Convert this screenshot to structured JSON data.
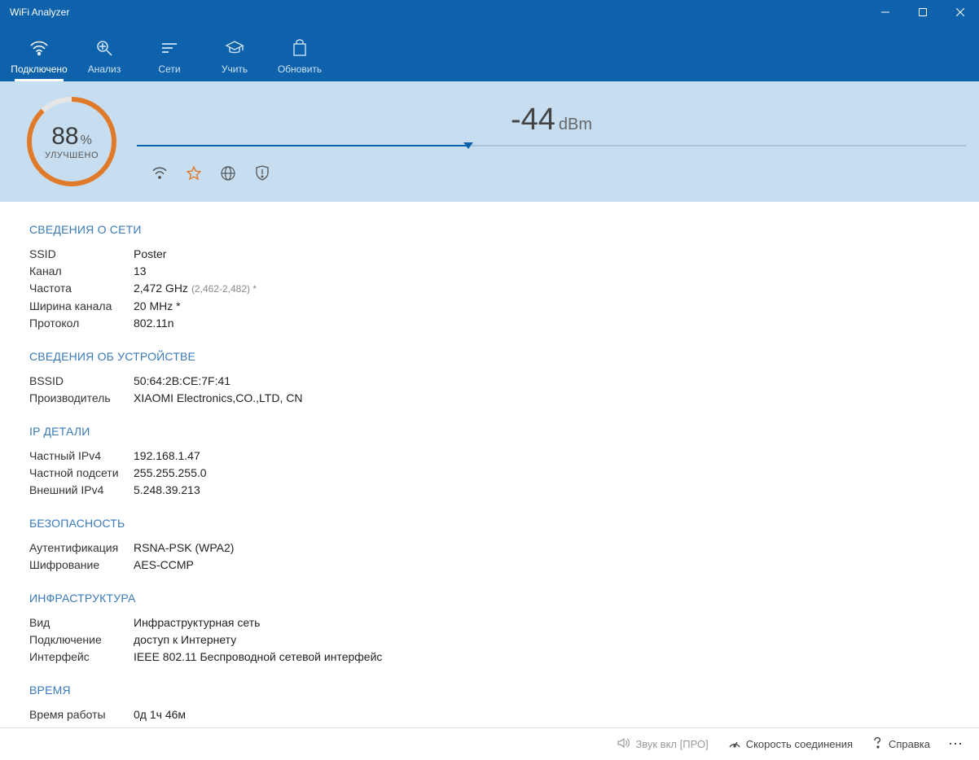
{
  "window": {
    "title": "WiFi Analyzer"
  },
  "toolbar": {
    "items": [
      {
        "label": "Подключено",
        "active": true
      },
      {
        "label": "Анализ",
        "active": false
      },
      {
        "label": "Cети",
        "active": false
      },
      {
        "label": "Учить",
        "active": false
      },
      {
        "label": "Обновить",
        "active": false
      }
    ]
  },
  "gauge": {
    "value": "88",
    "percent": "%",
    "sub": "УЛУЧШЕНО",
    "fill_percent": 88
  },
  "signal": {
    "value": "-44",
    "unit": "dBm",
    "fill_percent": 40
  },
  "sections": {
    "network": {
      "title": "СВЕДЕНИЯ О СЕТИ",
      "rows": [
        {
          "label": "SSID",
          "value": "Poster"
        },
        {
          "label": "Канал",
          "value": "13"
        },
        {
          "label": "Частота",
          "value": "2,472 GHz",
          "extra": "(2,462-2,482) *"
        },
        {
          "label": "Ширина канала",
          "value": "20 MHz *"
        },
        {
          "label": "Протокол",
          "value": "802.11n"
        }
      ]
    },
    "device": {
      "title": "СВЕДЕНИЯ ОБ УСТРОЙСТВЕ",
      "rows": [
        {
          "label": "BSSID",
          "value": "50:64:2B:CE:7F:41"
        },
        {
          "label": "Производитель",
          "value": "XIAOMI Electronics,CO.,LTD, CN"
        }
      ]
    },
    "ip": {
      "title": "IP ДЕТАЛИ",
      "rows": [
        {
          "label": "Частный IPv4",
          "value": "192.168.1.47"
        },
        {
          "label": "Частной подсети",
          "value": "255.255.255.0"
        },
        {
          "label": "Внешний IPv4",
          "value": "5.248.39.213"
        }
      ]
    },
    "security": {
      "title": "БЕЗОПАСНОСТЬ",
      "rows": [
        {
          "label": "Аутентификация",
          "value": "RSNA-PSK (WPA2)"
        },
        {
          "label": "Шифрование",
          "value": "AES-CCMP"
        }
      ]
    },
    "infra": {
      "title": "ИНФРАСТРУКТУРА",
      "rows": [
        {
          "label": "Вид",
          "value": "Инфраструктурная сеть"
        },
        {
          "label": "Подключение",
          "value": "доступ к Интернету"
        },
        {
          "label": "Интерфейс",
          "value": "IEEE 802.11 Беспроводной сетевой интерфейс"
        }
      ]
    },
    "time": {
      "title": "ВРЕМЯ",
      "rows": [
        {
          "label": "Время работы",
          "value": "0д 1ч 46м"
        }
      ]
    }
  },
  "bottombar": {
    "sound": "Звук вкл [ПРО]",
    "speed": "Скорость соединения",
    "help": "Справка"
  }
}
